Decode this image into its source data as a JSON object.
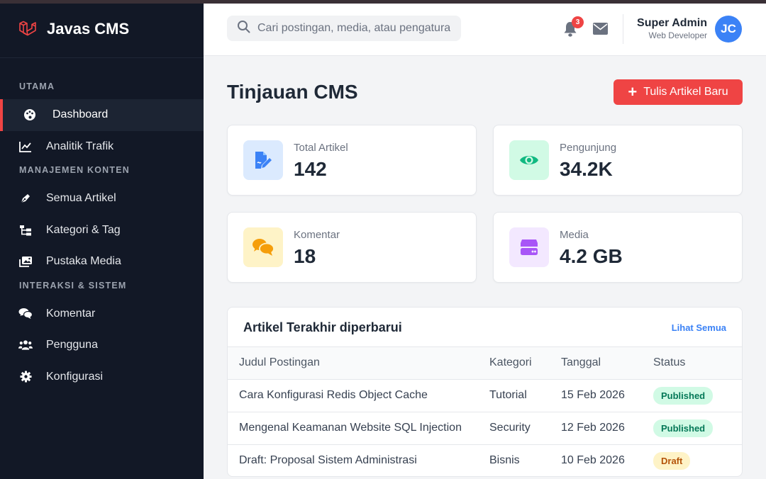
{
  "brand": {
    "name": "Javas CMS",
    "icon": "laravel-icon",
    "color": "#ef4444"
  },
  "sidebar": {
    "sections": [
      {
        "title": "UTAMA",
        "items": [
          {
            "label": "Dashboard",
            "icon": "palette-icon",
            "active": true
          },
          {
            "label": "Analitik Trafik",
            "icon": "chart-line-icon"
          }
        ]
      },
      {
        "title": "MANAJEMEN KONTEN",
        "items": [
          {
            "label": "Semua Artikel",
            "icon": "pen-nib-icon"
          },
          {
            "label": "Kategori & Tag",
            "icon": "sitemap-icon"
          },
          {
            "label": "Pustaka Media",
            "icon": "images-icon"
          }
        ]
      },
      {
        "title": "INTERAKSI & SISTEM",
        "items": [
          {
            "label": "Komentar",
            "icon": "comments-icon"
          },
          {
            "label": "Pengguna",
            "icon": "users-icon"
          },
          {
            "label": "Konfigurasi",
            "icon": "gear-icon"
          }
        ]
      }
    ]
  },
  "header": {
    "search_placeholder": "Cari postingan, media, atau pengaturan...",
    "notification_count": "3",
    "user_name": "Super Admin",
    "user_role": "Web Developer",
    "avatar_initials": "JC"
  },
  "main": {
    "title": "Tinjauan CMS",
    "new_button": "Tulis Artikel Baru",
    "stats": [
      {
        "label": "Total Artikel",
        "value": "142",
        "icon": "file-pen-icon",
        "color": "#3b82f6",
        "bg": "#dbeafe"
      },
      {
        "label": "Pengunjung",
        "value": "34.2K",
        "icon": "eye-icon",
        "color": "#10b981",
        "bg": "#d1fae5"
      },
      {
        "label": "Komentar",
        "value": "18",
        "icon": "comments-icon",
        "color": "#f59e0b",
        "bg": "#fef3c7"
      },
      {
        "label": "Media",
        "value": "4.2 GB",
        "icon": "hard-drive-icon",
        "color": "#a855f7",
        "bg": "#f3e8ff"
      }
    ]
  },
  "recent": {
    "title": "Artikel Terakhir diperbarui",
    "view_all": "Lihat Semua",
    "columns": [
      "Judul Postingan",
      "Kategori",
      "Tanggal",
      "Status"
    ],
    "rows": [
      {
        "title": "Cara Konfigurasi Redis Object Cache",
        "category": "Tutorial",
        "date": "15 Feb 2026",
        "status": "Published"
      },
      {
        "title": "Mengenal Keamanan Website SQL Injection",
        "category": "Security",
        "date": "12 Feb 2026",
        "status": "Published"
      },
      {
        "title": "Draft: Proposal Sistem Administrasi",
        "category": "Bisnis",
        "date": "10 Feb 2026",
        "status": "Draft"
      }
    ]
  }
}
